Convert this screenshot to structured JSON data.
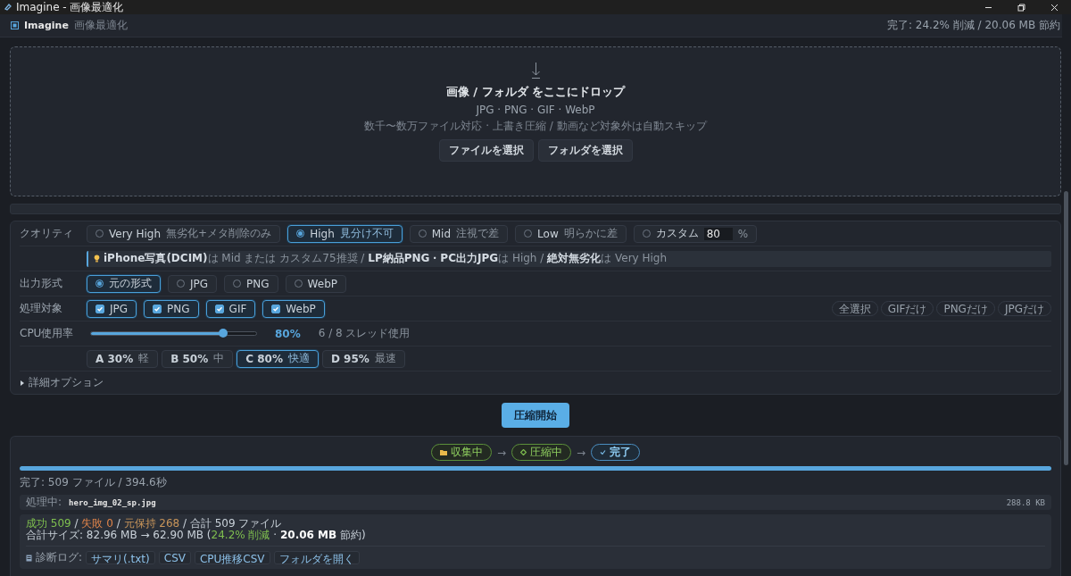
{
  "window": {
    "title": "Imagine - 画像最適化"
  },
  "header": {
    "app_name": "Imagine",
    "subtitle": "画像最適化",
    "status": "完了: 24.2% 削減 / 20.06 MB 節約"
  },
  "drop_zone": {
    "title": "画像 / フォルダ をここにドロップ",
    "formats": "JPG · PNG · GIF · WebP",
    "note": "数千〜数万ファイル対応 · 上書き圧縮 / 動画など対象外は自動スキップ",
    "buttons": [
      "ファイルを選択",
      "フォルダを選択"
    ]
  },
  "settings": {
    "quality": {
      "label": "クオリティ",
      "options": [
        {
          "label": "Very High",
          "sub": "無劣化+メタ削除のみ",
          "selected": false
        },
        {
          "label": "High",
          "sub": "見分け不可",
          "selected": true
        },
        {
          "label": "Mid",
          "sub": "注視で差",
          "selected": false
        },
        {
          "label": "Low",
          "sub": "明らかに差",
          "selected": false
        }
      ],
      "custom": {
        "label": "カスタム",
        "value": "80",
        "unit": "%",
        "selected": false
      },
      "tip": "**iPhone写真(DCIM)**は Mid または カスタム75推奨 / **LP納品PNG・PC出力JPG**は High / **絶対無劣化**は Very High"
    },
    "output": {
      "label": "出力形式",
      "options": [
        {
          "label": "元の形式",
          "selected": true
        },
        {
          "label": "JPG",
          "selected": false
        },
        {
          "label": "PNG",
          "selected": false
        },
        {
          "label": "WebP",
          "selected": false
        }
      ]
    },
    "targets": {
      "label": "処理対象",
      "items": [
        {
          "label": "JPG",
          "checked": true
        },
        {
          "label": "PNG",
          "checked": true
        },
        {
          "label": "GIF",
          "checked": true
        },
        {
          "label": "WebP",
          "checked": true
        }
      ],
      "quick": [
        "全選択",
        "GIFだけ",
        "PNGだけ",
        "JPGだけ"
      ]
    },
    "cpu": {
      "label": "CPU使用率",
      "level": 0.8,
      "reading": "80%",
      "threads": "6 / 8 スレッド使用"
    },
    "presets": [
      {
        "label": "A 30%",
        "sub": "軽",
        "selected": false
      },
      {
        "label": "B 50%",
        "sub": "中",
        "selected": false
      },
      {
        "label": "C 80%",
        "sub": "快適",
        "selected": true
      },
      {
        "label": "D 95%",
        "sub": "最速",
        "selected": false
      }
    ],
    "advanced": {
      "label": "詳細オプション",
      "expanded": false
    }
  },
  "start_button": "圧縮開始",
  "progress": {
    "steps": [
      {
        "kind": "folder",
        "label": "収集中",
        "selected": false
      },
      {
        "kind": "diamond",
        "label": "圧縮中",
        "selected": false
      },
      {
        "kind": "check",
        "label": "完了",
        "selected": true
      }
    ],
    "arrows": [
      "→",
      "→"
    ],
    "level": 1.0,
    "summary": "完了: 509 ファイル / 394.6秒",
    "current_label": "処理中:",
    "current_file": "hero_img_02_sp.jpg",
    "current_size": "288.8 KB",
    "stats": [
      {
        "text": "成功 509",
        "color": "#7fbf4f"
      },
      {
        "text": " / "
      },
      {
        "text": "失敗 0",
        "color": "#e0844a"
      },
      {
        "text": " / "
      },
      {
        "text": "元保持 268",
        "color": "#c8955a"
      },
      {
        "text": " / 合計 509 ファイル"
      }
    ],
    "size_line": [
      {
        "text": "合計サイズ: 82.96 MB → 62.90 MB ("
      },
      {
        "text": "24.2% 削減",
        "color": "#7fbf4f"
      },
      {
        "text": " · **20.06 MB** 節約)"
      }
    ],
    "log_label": "診断ログ:",
    "log_buttons": [
      "サマリ(.txt)",
      "CSV",
      "CPU推移CSV",
      "フォルダを開く"
    ]
  }
}
